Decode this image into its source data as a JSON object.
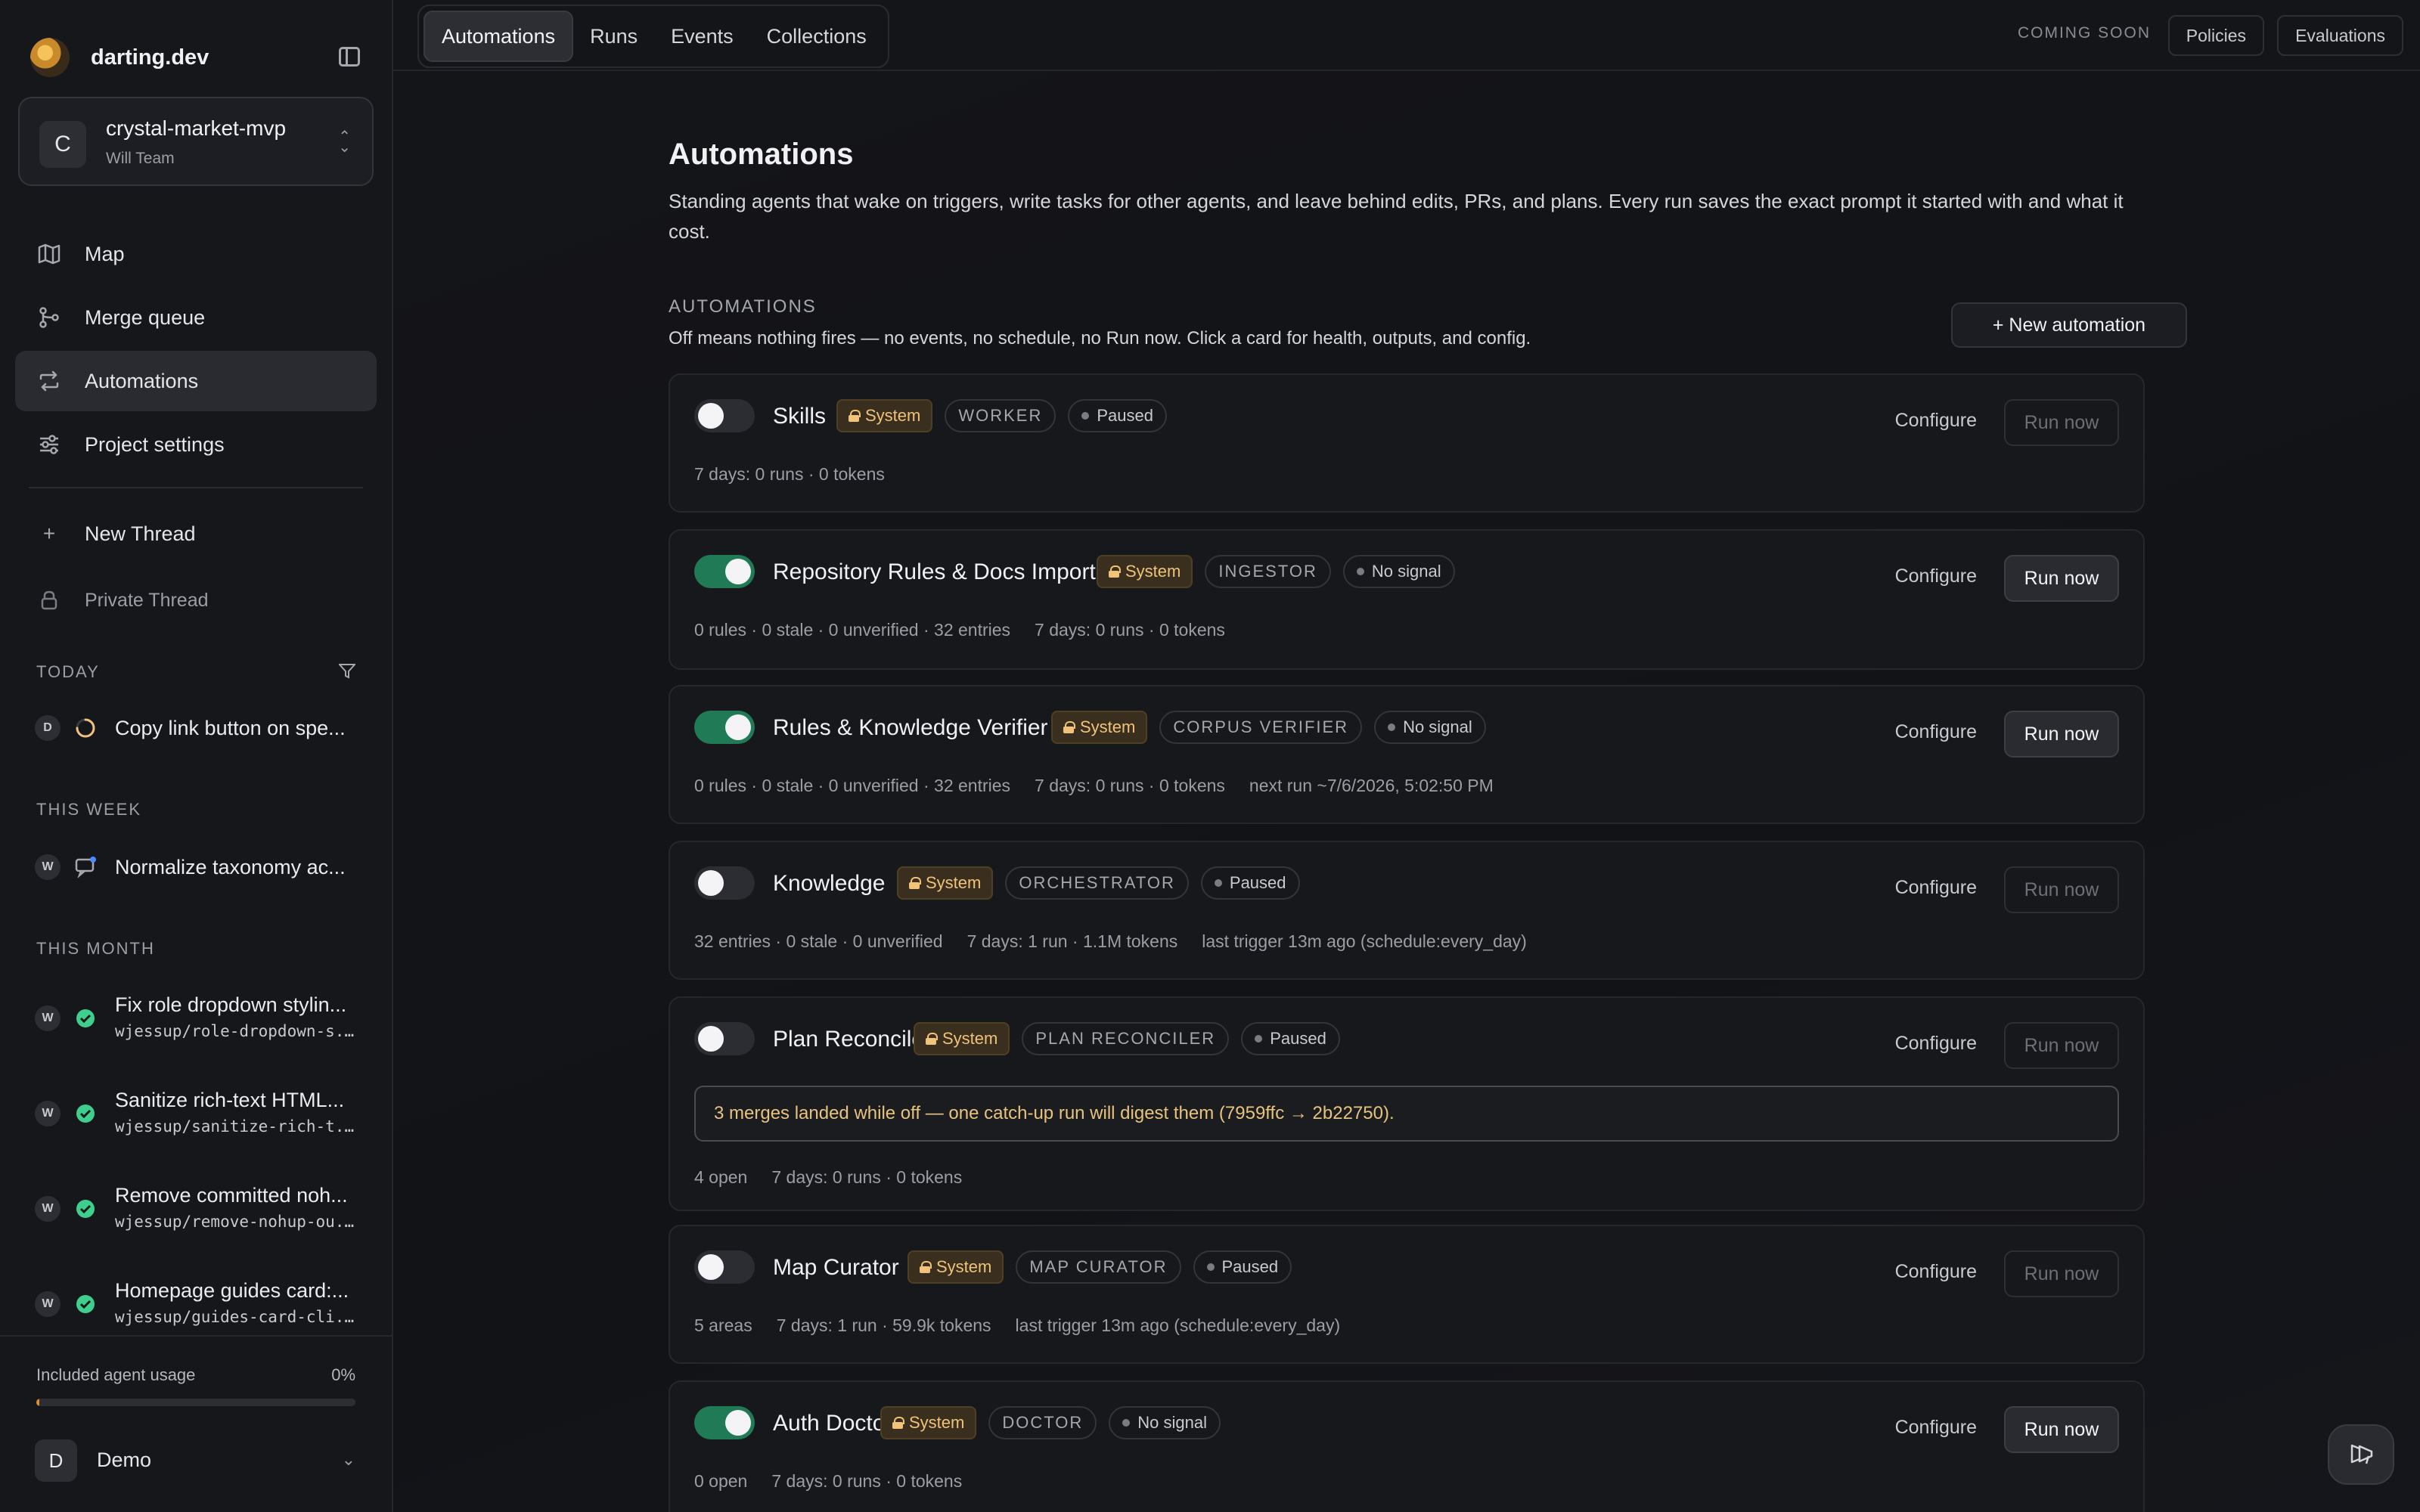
{
  "app": {
    "brand": "darting.dev"
  },
  "project": {
    "initial": "C",
    "name": "crystal-market-mvp",
    "team": "Will Team"
  },
  "nav": [
    {
      "label": "Map",
      "icon": "map-icon"
    },
    {
      "label": "Merge queue",
      "icon": "merge-icon"
    },
    {
      "label": "Automations",
      "icon": "repeat-icon",
      "active": true
    },
    {
      "label": "Project settings",
      "icon": "sliders-icon"
    }
  ],
  "thread_actions": {
    "new": "New Thread",
    "private": "Private Thread"
  },
  "groups": {
    "today": "TODAY",
    "week": "THIS WEEK",
    "month": "THIS MONTH"
  },
  "threads": {
    "today": [
      {
        "avatar": "D",
        "title": "Copy link button on spe...",
        "status": "running"
      }
    ],
    "week": [
      {
        "avatar": "W",
        "title": "Normalize taxonomy ac...",
        "status": "chat"
      }
    ],
    "month": [
      {
        "avatar": "W",
        "title": "Fix role dropdown stylin...",
        "branch": "wjessup/role-dropdown-s...",
        "status": "done"
      },
      {
        "avatar": "W",
        "title": "Sanitize rich-text HTML...",
        "branch": "wjessup/sanitize-rich-t...",
        "status": "done"
      },
      {
        "avatar": "W",
        "title": "Remove committed noh...",
        "branch": "wjessup/remove-nohup-ou...",
        "status": "done"
      },
      {
        "avatar": "W",
        "title": "Homepage guides card:...",
        "branch": "wjessup/guides-card-cli...",
        "status": "done"
      }
    ]
  },
  "usage": {
    "label": "Included agent usage",
    "percent_text": "0%",
    "fraction": 0.01,
    "fill_color": "#e08a2c"
  },
  "user": {
    "initial": "D",
    "name": "Demo"
  },
  "tabs": [
    {
      "label": "Automations",
      "active": true
    },
    {
      "label": "Runs"
    },
    {
      "label": "Events"
    },
    {
      "label": "Collections"
    }
  ],
  "top_right": {
    "coming_soon": "COMING SOON",
    "policies": "Policies",
    "evaluations": "Evaluations"
  },
  "page": {
    "title": "Automations",
    "description": "Standing agents that wake on triggers, write tasks for other agents, and leave behind edits, PRs, and plans. Every run saves the exact prompt it started with and what it cost.",
    "section_header": "AUTOMATIONS",
    "section_desc": "Off means nothing fires — no events, no schedule, no Run now. Click a card for health, outputs, and config.",
    "new_button": "+ New automation",
    "configure_label": "Configure",
    "run_label": "Run now"
  },
  "colors": {
    "toggle_on": "#1f7a55",
    "system_chip": "#f0c27a",
    "success": "#3ecf8e",
    "notice_text": "#e8c37d"
  },
  "automations": [
    {
      "name": "Skills",
      "system": "System",
      "role": "WORKER",
      "status": "Paused",
      "on": false,
      "stats": [
        "7 days: 0 runs · 0 tokens"
      ]
    },
    {
      "name": "Repository Rules & Docs Import",
      "system": "System",
      "role": "INGESTOR",
      "status": "No signal",
      "on": true,
      "stats": [
        "0 rules · 0 stale · 0 unverified · 32 entries",
        "7 days: 0 runs · 0 tokens"
      ]
    },
    {
      "name": "Rules & Knowledge Verifier",
      "system": "System",
      "role": "CORPUS VERIFIER",
      "status": "No signal",
      "on": true,
      "stats": [
        "0 rules · 0 stale · 0 unverified · 32 entries",
        "7 days: 0 runs · 0 tokens",
        "next run ~7/6/2026, 5:02:50 PM"
      ]
    },
    {
      "name": "Knowledge",
      "system": "System",
      "role": "ORCHESTRATOR",
      "status": "Paused",
      "on": false,
      "stats": [
        "32 entries · 0 stale · 0 unverified",
        "7 days: 1 run · 1.1M tokens",
        "last trigger 13m ago (schedule:every_day)"
      ]
    },
    {
      "name": "Plan Reconcile",
      "system": "System",
      "role": "PLAN RECONCILER",
      "status": "Paused",
      "on": false,
      "notice": "3 merges landed while off — one catch-up run will digest them (7959ffc → 2b22750).",
      "stats": [
        "4 open",
        "7 days: 0 runs · 0 tokens"
      ]
    },
    {
      "name": "Map Curator",
      "system": "System",
      "role": "MAP CURATOR",
      "status": "Paused",
      "on": false,
      "stats": [
        "5 areas",
        "7 days: 1 run · 59.9k tokens",
        "last trigger 13m ago (schedule:every_day)"
      ]
    },
    {
      "name": "Auth Doctor",
      "system": "System",
      "role": "DOCTOR",
      "status": "No signal",
      "on": true,
      "stats": [
        "0 open",
        "7 days: 0 runs · 0 tokens"
      ]
    }
  ]
}
